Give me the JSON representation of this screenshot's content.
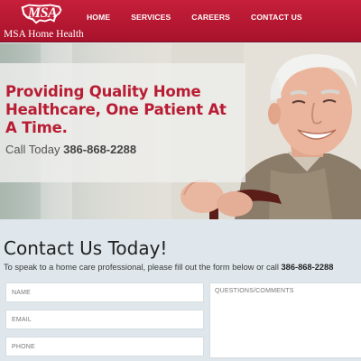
{
  "header": {
    "logo_mark": "MSA",
    "site_name": "MSA Home Health",
    "nav": [
      "HOME",
      "SERVICES",
      "CAREERS",
      "CONTACT US"
    ]
  },
  "hero": {
    "headline": "Providing Quality Home Healthcare, One Patient At A Time.",
    "call_prefix": "Call Today",
    "phone": "386-868-2288"
  },
  "contact": {
    "title": "Contact Us Today!",
    "subtitle": "To speak to a home care professional, please fill out the form below or call",
    "phone": "386-868-2288",
    "fields": {
      "name_placeholder": "NAME",
      "email_placeholder": "EMAIL",
      "phone_placeholder": "PHONE",
      "comments_placeholder": "QUESTIONS/COMMENTS"
    }
  },
  "colors": {
    "brand_red": "#b81c33",
    "header_red": "#c61f3a",
    "section_bg": "#dfe7ec"
  }
}
